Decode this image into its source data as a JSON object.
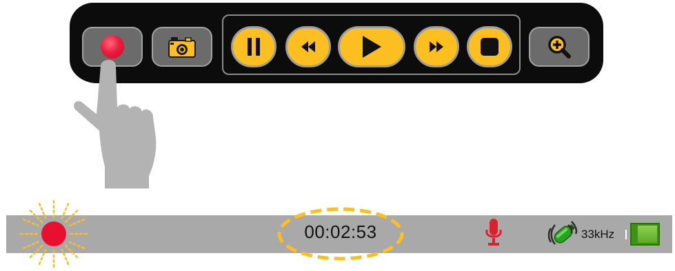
{
  "toolbar": {
    "buttons": [
      {
        "id": "record",
        "icon": "record-icon",
        "color": "#ee1c3d"
      },
      {
        "id": "snapshot",
        "icon": "camera-icon"
      },
      {
        "id": "pause",
        "icon": "pause-icon"
      },
      {
        "id": "rewind",
        "icon": "rewind-icon"
      },
      {
        "id": "play",
        "icon": "play-icon"
      },
      {
        "id": "fast_forward",
        "icon": "fast-forward-icon"
      },
      {
        "id": "stop",
        "icon": "stop-icon"
      },
      {
        "id": "zoom_in",
        "icon": "zoom-in-icon"
      }
    ],
    "accent_color": "#fdbf1f"
  },
  "status_bar": {
    "recording": true,
    "elapsed_time": "00:02:53",
    "microphone": "mic-icon",
    "rf_icon": "rf-signal-icon",
    "frequency": "33kHz",
    "battery_level": 0.8,
    "battery_color": "#5cab26"
  }
}
